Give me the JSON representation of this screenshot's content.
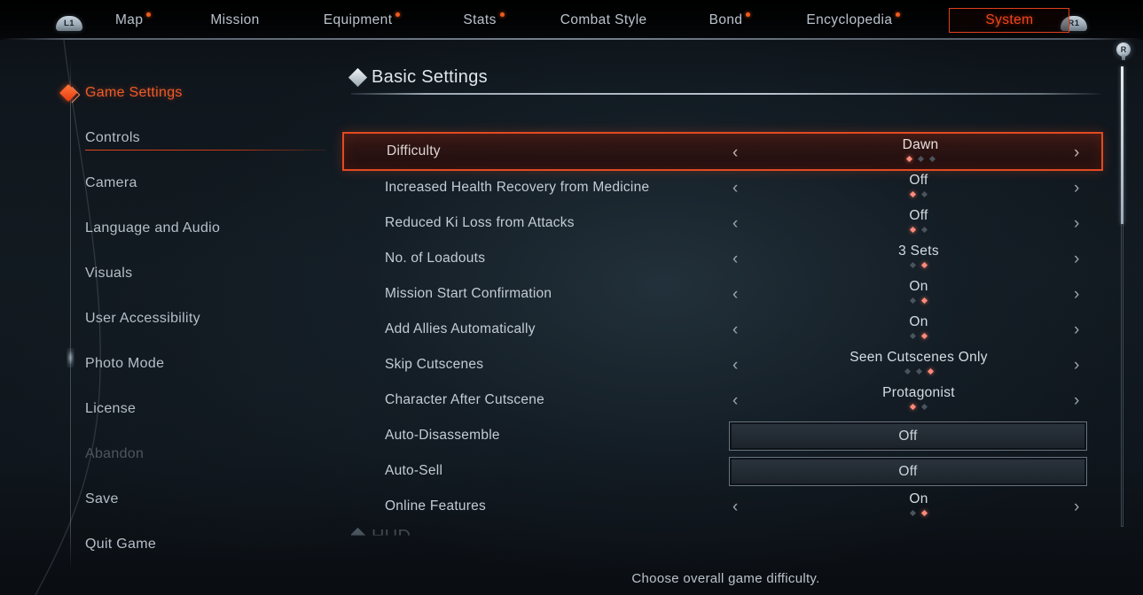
{
  "topnav": {
    "left_button": "L1",
    "right_button": "R1",
    "items": [
      {
        "label": "Map",
        "has_dot": true,
        "active": false
      },
      {
        "label": "Mission",
        "has_dot": false,
        "active": false
      },
      {
        "label": "Equipment",
        "has_dot": true,
        "active": false
      },
      {
        "label": "Stats",
        "has_dot": true,
        "active": false
      },
      {
        "label": "Combat Style",
        "has_dot": false,
        "active": false
      },
      {
        "label": "Bond",
        "has_dot": true,
        "active": false
      },
      {
        "label": "Encyclopedia",
        "has_dot": true,
        "active": false
      },
      {
        "label": "System",
        "has_dot": false,
        "active": true
      }
    ]
  },
  "sidebar": {
    "items": [
      {
        "label": "Game Settings",
        "state": "active"
      },
      {
        "label": "Controls",
        "state": "normal"
      },
      {
        "label": "Camera",
        "state": "normal"
      },
      {
        "label": "Language and Audio",
        "state": "normal"
      },
      {
        "label": "Visuals",
        "state": "normal"
      },
      {
        "label": "User Accessibility",
        "state": "normal"
      },
      {
        "label": "Photo Mode",
        "state": "normal"
      },
      {
        "label": "License",
        "state": "normal"
      },
      {
        "label": "Abandon",
        "state": "disabled"
      },
      {
        "label": "Save",
        "state": "normal"
      },
      {
        "label": "Quit Game",
        "state": "normal"
      }
    ]
  },
  "main": {
    "section_title": "Basic Settings",
    "next_section_title": "HUD",
    "help_text": "Choose overall game difficulty.",
    "chevron_left": "‹",
    "chevron_right": "›",
    "rows": [
      {
        "label": "Difficulty",
        "value": "Dawn",
        "control": "stepper",
        "dots_total": 3,
        "dots_active": 1,
        "selected": true
      },
      {
        "label": "Increased Health Recovery from Medicine",
        "value": "Off",
        "control": "stepper",
        "dots_total": 2,
        "dots_active": 1,
        "selected": false
      },
      {
        "label": "Reduced Ki Loss from Attacks",
        "value": "Off",
        "control": "stepper",
        "dots_total": 2,
        "dots_active": 1,
        "selected": false
      },
      {
        "label": "No. of Loadouts",
        "value": "3 Sets",
        "control": "stepper",
        "dots_total": 2,
        "dots_active": 2,
        "selected": false
      },
      {
        "label": "Mission Start Confirmation",
        "value": "On",
        "control": "stepper",
        "dots_total": 2,
        "dots_active": 2,
        "selected": false
      },
      {
        "label": "Add Allies Automatically",
        "value": "On",
        "control": "stepper",
        "dots_total": 2,
        "dots_active": 2,
        "selected": false
      },
      {
        "label": "Skip Cutscenes",
        "value": "Seen Cutscenes Only",
        "control": "stepper",
        "dots_total": 3,
        "dots_active": 3,
        "selected": false
      },
      {
        "label": "Character After Cutscene",
        "value": "Protagonist",
        "control": "stepper",
        "dots_total": 2,
        "dots_active": 1,
        "selected": false
      },
      {
        "label": "Auto-Disassemble",
        "value": "Off",
        "control": "button",
        "selected": false
      },
      {
        "label": "Auto-Sell",
        "value": "Off",
        "control": "button",
        "selected": false
      },
      {
        "label": "Online Features",
        "value": "On",
        "control": "stepper",
        "dots_total": 2,
        "dots_active": 2,
        "selected": false
      }
    ]
  },
  "scrollbar": {
    "stick_label": "R"
  },
  "colors": {
    "accent": "#f0461c",
    "accent_dot": "#ef5a1e",
    "selected_border": "#e24a21",
    "dot_active": "#ff8a7a",
    "dot_inactive": "#4a545c",
    "text_primary": "#c3ccd4",
    "background": "#161f27"
  }
}
